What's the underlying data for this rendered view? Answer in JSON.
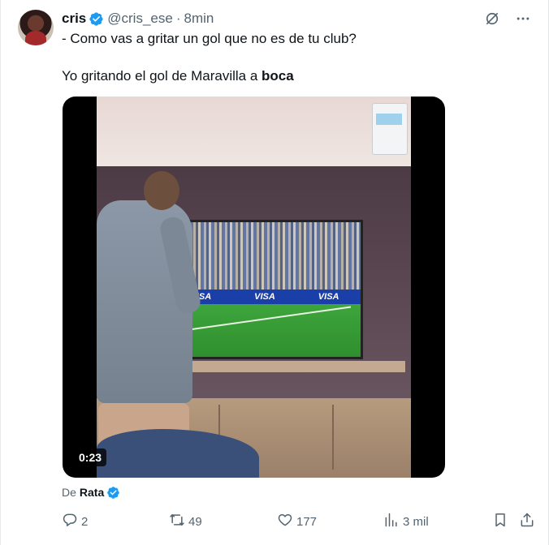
{
  "tweet": {
    "author_name": "cris",
    "author_handle": "@cris_ese",
    "separator": "·",
    "time": "8min",
    "text_line1": "- Como vas a gritar un gol que no es de tu club?",
    "text_line2_prefix": "Yo gritando el gol de Maravilla a ",
    "text_line2_bold": "boca"
  },
  "media": {
    "duration": "0:23",
    "board_text": [
      "VISA",
      "VISA",
      "VISA"
    ]
  },
  "source": {
    "label": "De",
    "name": "Rata"
  },
  "actions": {
    "replies": "2",
    "retweets": "49",
    "likes": "177",
    "views": "3 mil"
  },
  "colors": {
    "text": "#0f1419",
    "secondary": "#536471",
    "verified": "#1d9bf0"
  }
}
